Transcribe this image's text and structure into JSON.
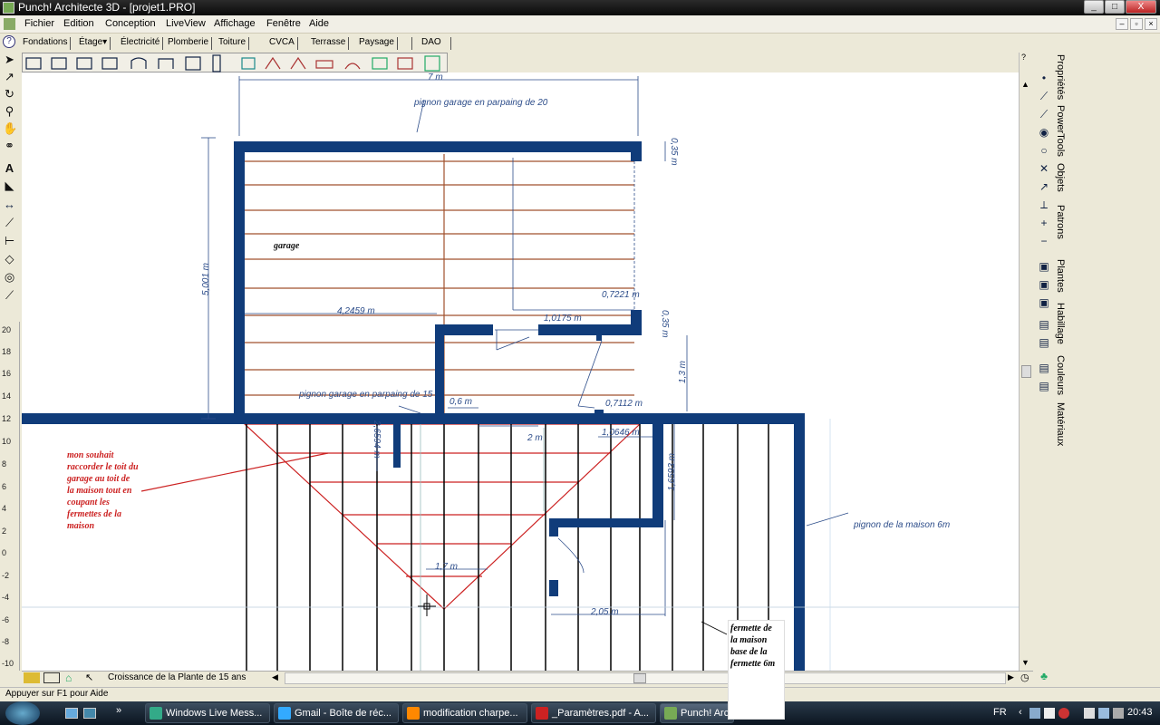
{
  "window": {
    "title": "Punch! Architecte 3D - [projet1.PRO]",
    "controls": {
      "minimize": "_",
      "maximize": "□",
      "close": "X"
    }
  },
  "menu": {
    "items": [
      "Fichier",
      "Edition",
      "Conception",
      "LiveView",
      "Affichage",
      "Fenêtre",
      "Aide"
    ]
  },
  "tabs": {
    "items": [
      "Fondations",
      "Étage",
      "Électricité",
      "Plomberie",
      "Toiture",
      "CVCA",
      "Terrasse",
      "Paysage",
      "DAO"
    ],
    "active": "Étage"
  },
  "ruler": {
    "ticks": [
      "20",
      "18",
      "16",
      "14",
      "12",
      "10",
      "8",
      "6",
      "4",
      "2",
      "0",
      "-2",
      "-4",
      "-6",
      "-8",
      "-10"
    ]
  },
  "right_panel": {
    "tabs": [
      "Propriétés",
      "PowerTools",
      "Objets",
      "Patrons",
      "Plantes",
      "Habillage",
      "Couleurs",
      "Matériaux"
    ]
  },
  "drawing": {
    "dimensions": {
      "d7m": "7 m",
      "d035a": "0,35 m",
      "d5001": "5,001 m",
      "d42459": "4,2459 m",
      "d07221": "0,7221 m",
      "d10175": "1,0175 m",
      "d035b": "0,35 m",
      "d13": "1,3 m",
      "d06": "0,6 m",
      "d07112": "0,7112 m",
      "d2": "2 m",
      "d10646": "1,0646 m",
      "d16593": "1,6593 m",
      "d26594": "2,6594 m",
      "d17": "1,7 m",
      "d205": "2,05 m"
    },
    "labels": {
      "pignon_garage_20": "pignon garage en parpaing de 20",
      "garage": "garage",
      "pignon_garage_15": "pignon garage en parpaing de 15",
      "pignon_maison": "pignon de la maison 6m"
    },
    "notes": {
      "souhait": [
        "mon souhait",
        "raccorder le toit du",
        "garage au toit de",
        "la maison tout en",
        "coupant les",
        "fermettes de la",
        "maison"
      ],
      "fermette": [
        "fermette de",
        "la maison",
        "base de la",
        "fermette 6m"
      ]
    },
    "colors": {
      "wall": "#103c7a",
      "dimension": "#2d4d8a",
      "rafter": "#a0522d",
      "red": "#cc2222"
    }
  },
  "bottom": {
    "plant_growth": "Croissance de la Plante de 15 ans"
  },
  "status": {
    "text": "Appuyer sur F1 pour Aide"
  },
  "taskbar": {
    "tasks": [
      "Windows Live Mess...",
      "Gmail - Boîte de réc...",
      "modification charpe...",
      "_Paramètres.pdf - A...",
      "Punch! Arc"
    ],
    "lang": "FR",
    "clock": "20:43"
  }
}
